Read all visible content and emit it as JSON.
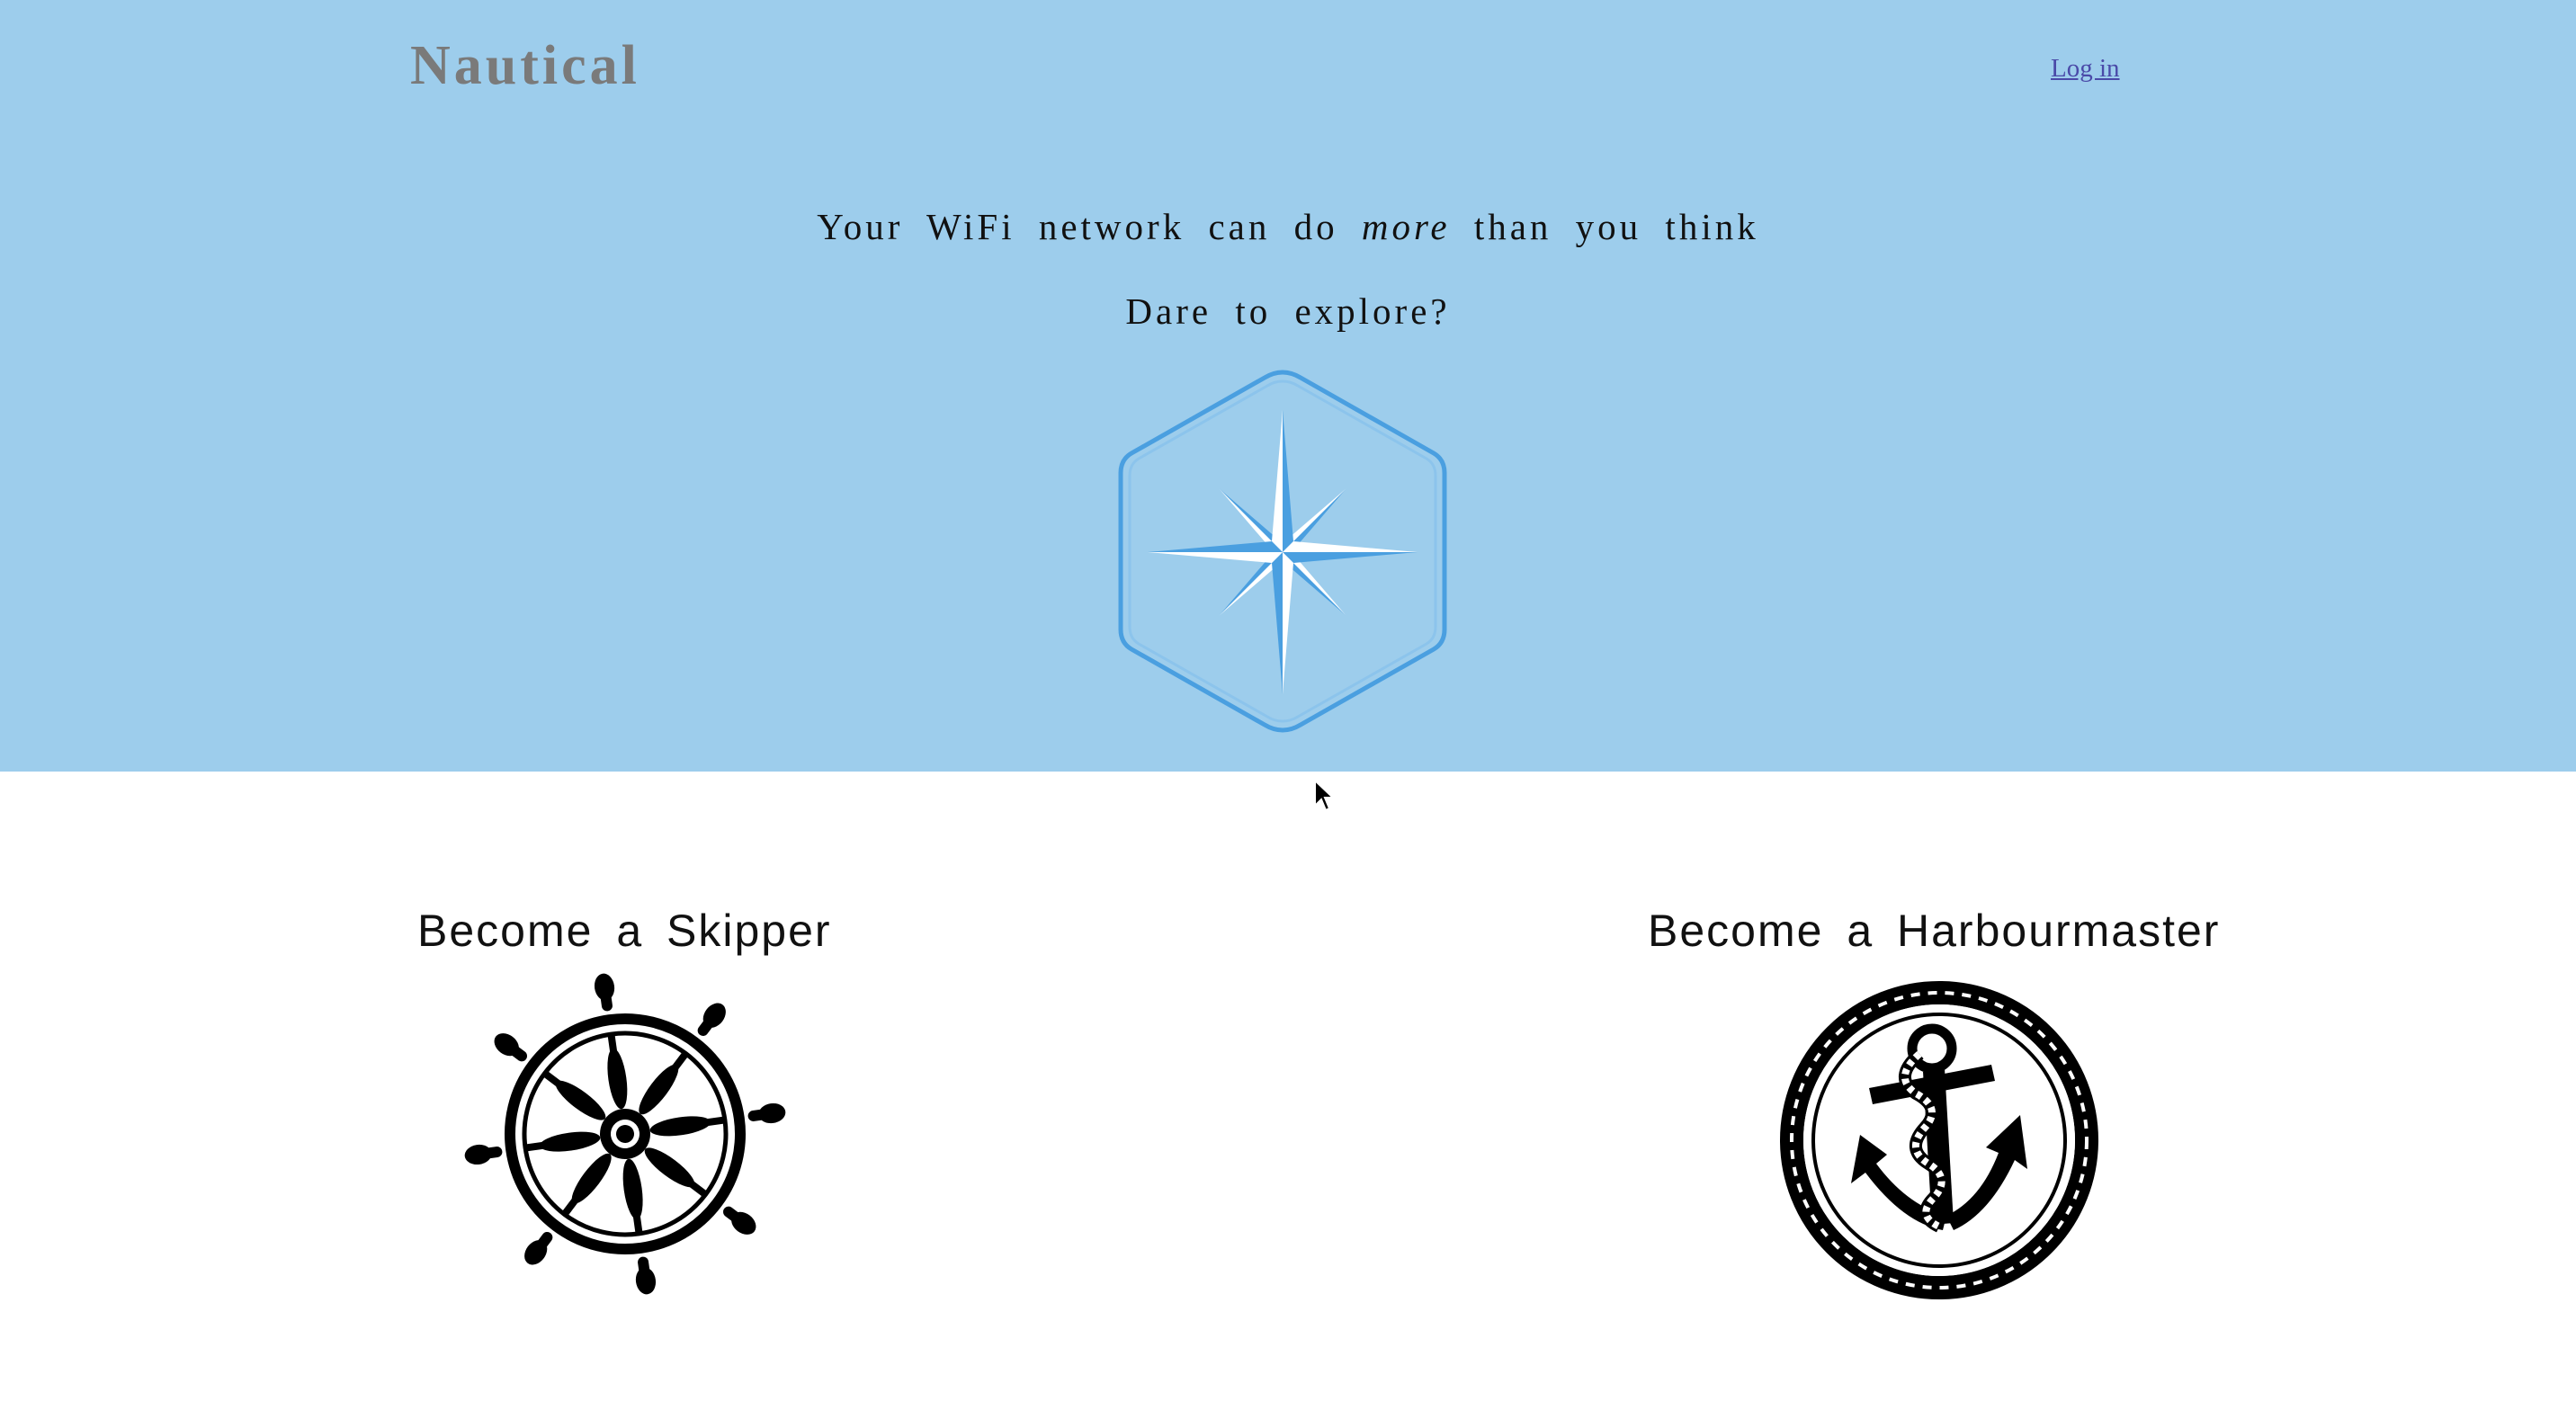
{
  "header": {
    "brand": "Nautical",
    "login_label": "Log in"
  },
  "hero": {
    "line1_before": "Your WiFi network can do ",
    "line1_emphasis": "more",
    "line1_after": " than you think",
    "line2": "Dare to explore?",
    "icon": "compass-rose-icon"
  },
  "roles": [
    {
      "title": "Become a Skipper",
      "icon": "ship-wheel-icon"
    },
    {
      "title": "Become a Harbourmaster",
      "icon": "anchor-icon"
    }
  ],
  "colors": {
    "hero_background": "#9dcdec",
    "brand_text": "#7a7a7a",
    "link": "#4a4aa8",
    "compass_blue": "#4a9fe0"
  }
}
